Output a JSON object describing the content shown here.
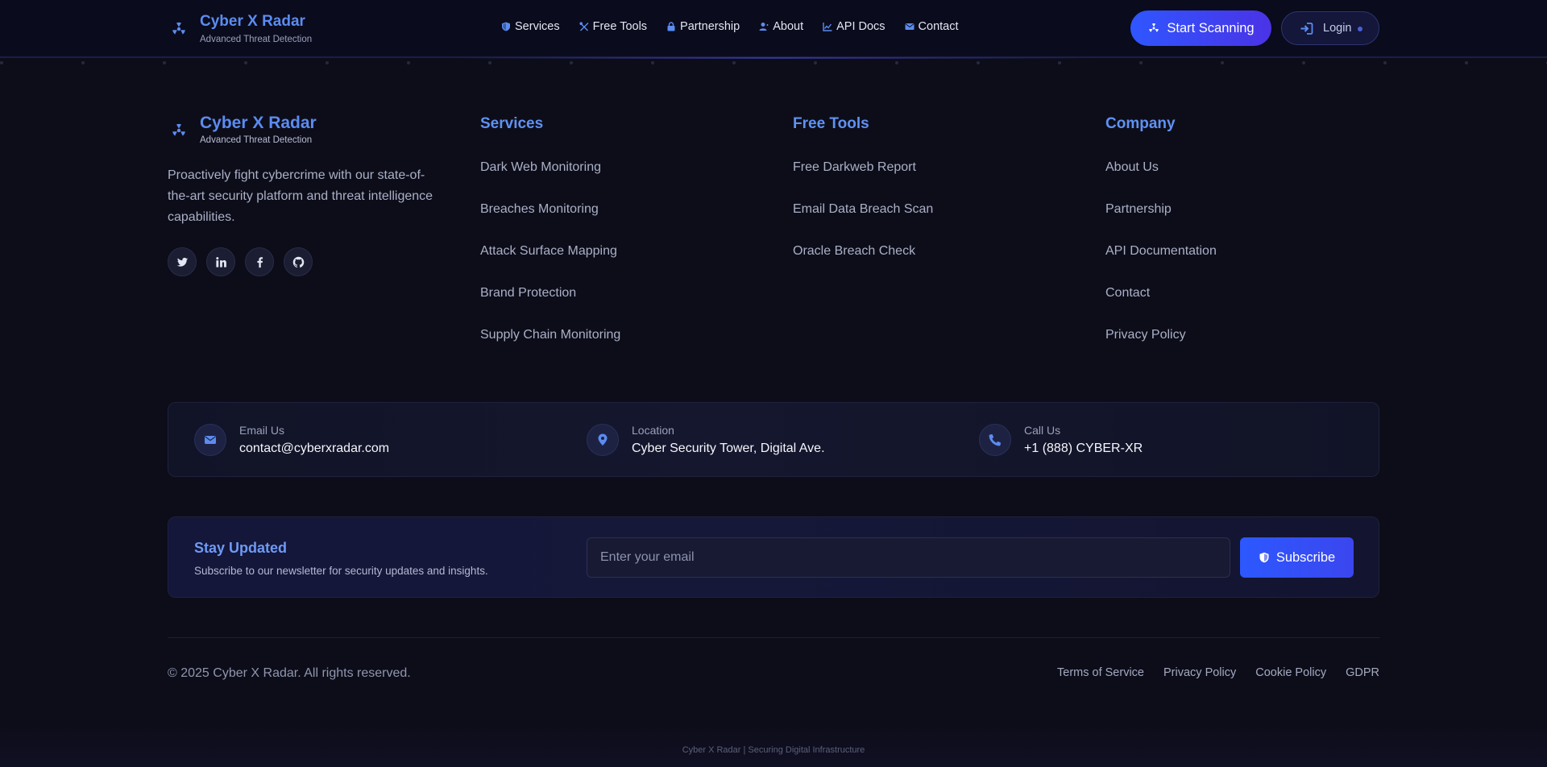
{
  "colors": {
    "accent": "#5b8cf0",
    "primary_button": "#2f56ff",
    "background": "#0d0d1a"
  },
  "navbar": {
    "brand_title": "Cyber X Radar",
    "brand_subtitle": "Advanced Threat Detection",
    "brand_icon": "radiation-icon",
    "links": [
      {
        "label": "Services",
        "icon": "shield-icon"
      },
      {
        "label": "Free Tools",
        "icon": "tools-icon"
      },
      {
        "label": "Partnership",
        "icon": "lock-icon"
      },
      {
        "label": "About",
        "icon": "user-icon"
      },
      {
        "label": "API Docs",
        "icon": "chart-icon"
      },
      {
        "label": "Contact",
        "icon": "envelope-icon"
      }
    ],
    "start_scanning_label": "Start Scanning",
    "login_label": "Login"
  },
  "footer": {
    "brand_title": "Cyber X Radar",
    "brand_subtitle": "Advanced Threat Detection",
    "description": "Proactively fight cybercrime with our state-of-the-art security platform and threat intelligence capabilities.",
    "socials": [
      "twitter-icon",
      "linkedin-icon",
      "facebook-icon",
      "github-icon"
    ],
    "columns": [
      {
        "title": "Services",
        "items": [
          "Dark Web Monitoring",
          "Breaches Monitoring",
          "Attack Surface Mapping",
          "Brand Protection",
          "Supply Chain Monitoring"
        ]
      },
      {
        "title": "Free Tools",
        "items": [
          "Free Darkweb Report",
          "Email Data Breach Scan",
          "Oracle Breach Check"
        ]
      },
      {
        "title": "Company",
        "items": [
          "About Us",
          "Partnership",
          "API Documentation",
          "Contact",
          "Privacy Policy"
        ]
      }
    ],
    "contact": [
      {
        "label": "Email Us",
        "value": "contact@cyberxradar.com",
        "icon": "envelope-icon"
      },
      {
        "label": "Location",
        "value": "Cyber Security Tower, Digital Ave.",
        "icon": "map-pin-icon"
      },
      {
        "label": "Call Us",
        "value": "+1 (888) CYBER-XR",
        "icon": "phone-icon"
      }
    ],
    "newsletter": {
      "title": "Stay Updated",
      "subtitle": "Subscribe to our newsletter for security updates and insights.",
      "placeholder": "Enter your email",
      "button_label": "Subscribe"
    },
    "copyright": "© 2025 Cyber X Radar. All rights reserved.",
    "legal_links": [
      "Terms of Service",
      "Privacy Policy",
      "Cookie Policy",
      "GDPR"
    ],
    "tagline": "Cyber X Radar | Securing Digital Infrastructure"
  }
}
